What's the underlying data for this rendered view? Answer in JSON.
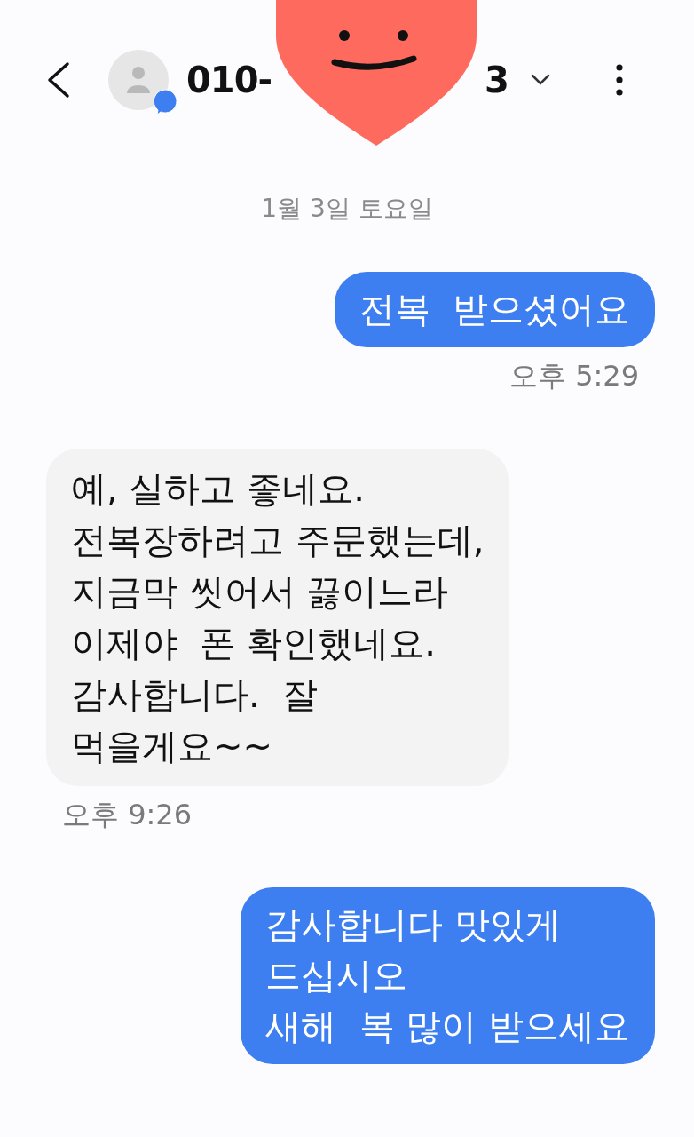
{
  "header": {
    "title_start": "010-",
    "title_end": "3",
    "avatar_badge": true
  },
  "date": "1월 3일 토요일",
  "messages": [
    {
      "kind": "sent",
      "text": "전복  받으셨어요",
      "time": "오후 5:29"
    },
    {
      "kind": "received",
      "text": "예, 실하고 좋네요.\n전복장하려고 주문했는데,\n지금막 씻어서 끓이느라\n이제야  폰 확인했네요.\n감사합니다.  잘\n먹을게요~~",
      "time": "오후 9:26"
    },
    {
      "kind": "sent",
      "text": "감사합니다 맛있게\n드십시오\n새해  복 많이 받으세요"
    }
  ]
}
